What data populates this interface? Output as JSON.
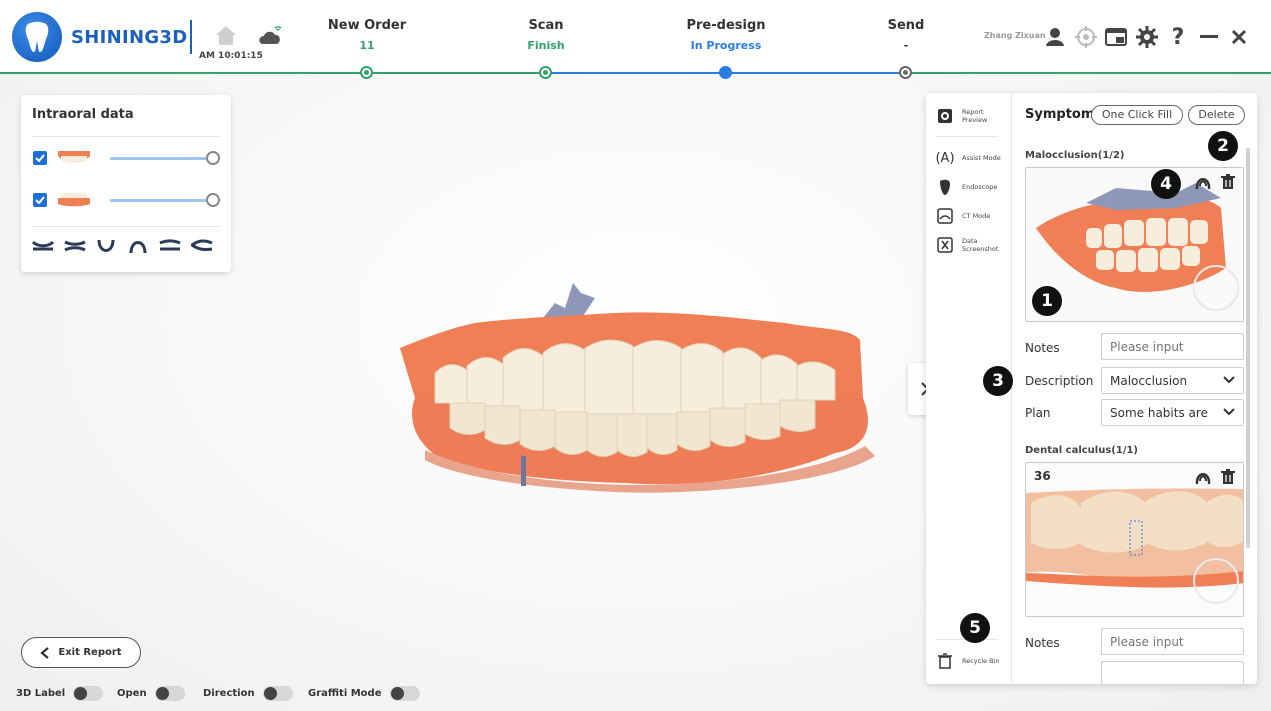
{
  "header": {
    "brand": "SHINING3D",
    "clock": "AM 10:01:15",
    "user_name": "Zhang Zixuan",
    "steps": [
      {
        "title": "New Order",
        "status": "11",
        "status_color": "#2fa36a"
      },
      {
        "title": "Scan",
        "status": "Finish",
        "status_color": "#2fa36a"
      },
      {
        "title": "Pre-design",
        "status": "In Progress",
        "status_color": "#2a7de1"
      },
      {
        "title": "Send",
        "status": "-",
        "status_color": "#333333"
      }
    ],
    "icons": [
      "home-icon",
      "cloud-wifi-icon",
      "user-icon",
      "target-icon",
      "screen-capture-icon",
      "gear-icon",
      "help-icon",
      "minimize-icon",
      "close-icon"
    ]
  },
  "left_panel": {
    "title": "Intraoral data",
    "layers": [
      {
        "name": "upper-jaw",
        "checked": true,
        "opacity": 1.0
      },
      {
        "name": "lower-jaw",
        "checked": true,
        "opacity": 1.0
      }
    ],
    "view_icons": [
      "view-upper-icon",
      "view-front-icon",
      "view-lower-icon",
      "view-arch-icon",
      "view-left-icon",
      "view-right-icon"
    ]
  },
  "side_tools": [
    {
      "label": "Report Preview",
      "icon": "report-preview-icon"
    },
    {
      "label": "Assist Mode",
      "icon": "assist-mode-icon"
    },
    {
      "label": "Endoscope",
      "icon": "endoscope-icon"
    },
    {
      "label": "CT Mode",
      "icon": "ct-mode-icon"
    },
    {
      "label": "Data Screenshot",
      "icon": "data-screenshot-icon"
    },
    {
      "label": "Recycle Bin",
      "icon": "recycle-bin-icon"
    }
  ],
  "symptom": {
    "title": "Symptom",
    "one_click_fill": "One Click Fill",
    "delete": "Delete",
    "sections": [
      {
        "title": "Malocclusion(1/2)",
        "notes_label": "Notes",
        "notes_placeholder": "Please input",
        "description_label": "Description",
        "description_value": "Malocclusion",
        "plan_label": "Plan",
        "plan_value": "Some habits are"
      },
      {
        "title": "Dental calculus(1/1)",
        "tooth_number": "36",
        "notes_label": "Notes",
        "notes_placeholder": "Please input"
      }
    ]
  },
  "badges": [
    "1",
    "2",
    "3",
    "4",
    "5"
  ],
  "bottom": {
    "exit_report": "Exit Report",
    "toggles": [
      {
        "label": "3D Label",
        "on": false
      },
      {
        "label": "Open",
        "on": false
      },
      {
        "label": "Direction",
        "on": false
      },
      {
        "label": "Graffiti Mode",
        "on": false
      }
    ]
  },
  "colors": {
    "brand_blue": "#1b5fbf",
    "step_green": "#2fa36a",
    "step_blue": "#2a7de1",
    "gingiva": "#f07f56",
    "tooth": "#f6eddc"
  }
}
